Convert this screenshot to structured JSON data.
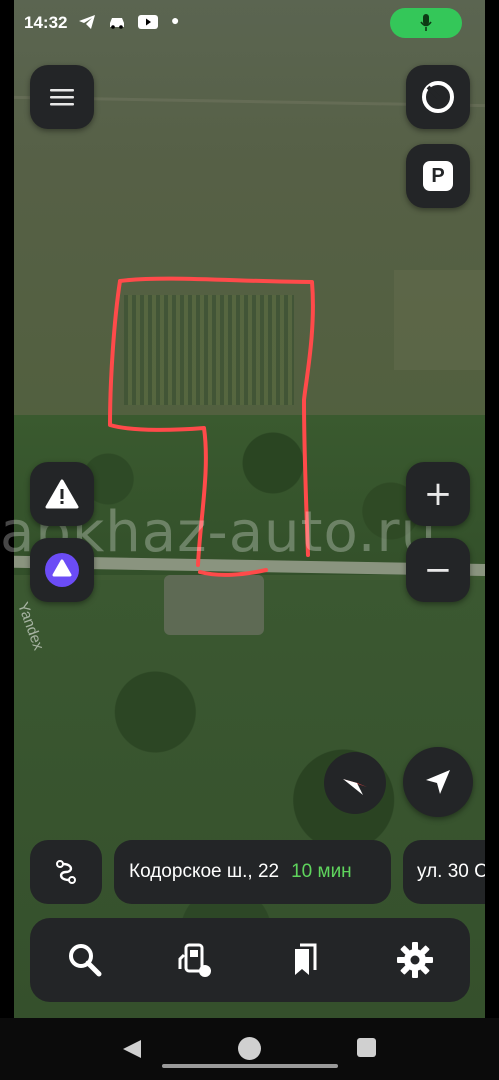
{
  "status_bar": {
    "time": "14:32",
    "icons": [
      "telegram-icon",
      "car-icon",
      "youtube-icon",
      "dot"
    ],
    "mic_color": "#34c759"
  },
  "map": {
    "watermark": "abkhaz-auto.ru",
    "provider_label": "Yandex",
    "outline_color": "#ff4a4a"
  },
  "controls": {
    "menu": "menu-icon",
    "alice_top": "alice-ring-icon",
    "parking_label": "P",
    "alert": "alert-icon",
    "alice": "alice-icon",
    "zoom_in": "+",
    "zoom_out": "−",
    "compass": "compass-icon",
    "my_location": "navigation-arrow-icon"
  },
  "routes": [
    {
      "address": "Кодорское ш., 22",
      "eta": "10 мин"
    },
    {
      "address": "ул. 30 С"
    }
  ],
  "toolbar": {
    "items": [
      "search-icon",
      "fuel-station-icon",
      "bookmarks-icon",
      "settings-icon"
    ]
  },
  "colors": {
    "accent_green": "#5fd45d",
    "button_bg": "#232527",
    "alice_purple": "#6b4cf6"
  }
}
